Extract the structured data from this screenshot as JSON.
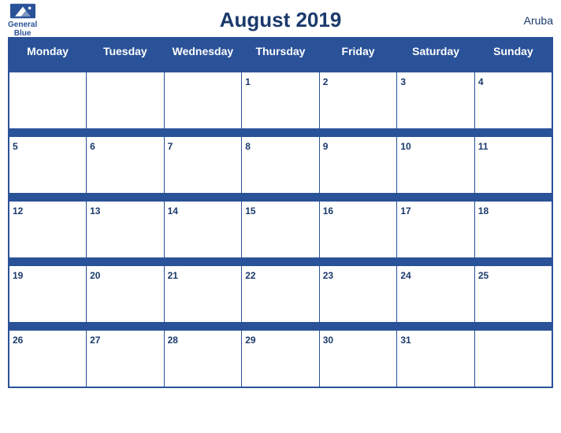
{
  "header": {
    "logo_text_line1": "General",
    "logo_text_line2": "Blue",
    "title": "August 2019",
    "country": "Aruba"
  },
  "weekdays": [
    "Monday",
    "Tuesday",
    "Wednesday",
    "Thursday",
    "Friday",
    "Saturday",
    "Sunday"
  ],
  "weeks": [
    [
      null,
      null,
      null,
      1,
      2,
      3,
      4
    ],
    [
      5,
      6,
      7,
      8,
      9,
      10,
      11
    ],
    [
      12,
      13,
      14,
      15,
      16,
      17,
      18
    ],
    [
      19,
      20,
      21,
      22,
      23,
      24,
      25
    ],
    [
      26,
      27,
      28,
      29,
      30,
      31,
      null
    ]
  ],
  "colors": {
    "header_bg": "#2a5298",
    "header_text": "#ffffff",
    "title_color": "#1a3a6b",
    "day_number_color": "#1a3a6b"
  }
}
